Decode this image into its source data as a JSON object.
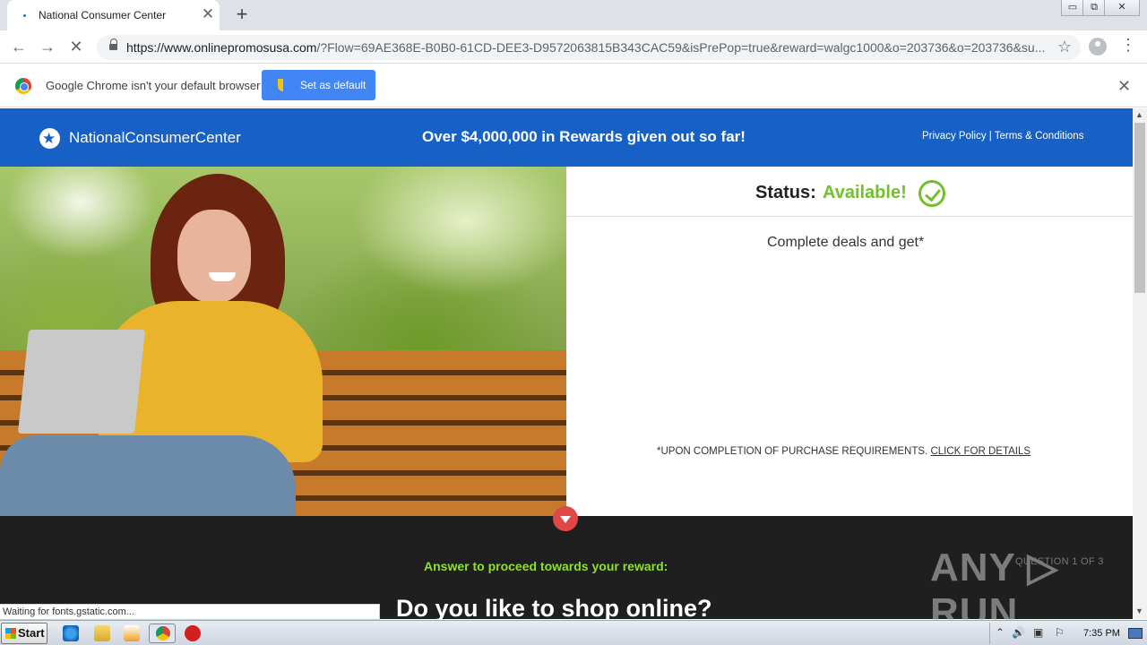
{
  "browser": {
    "tab_title": "National Consumer Center",
    "tab_close": "✕",
    "new_tab": "+",
    "url_host": "https://www.onlinepromosusa.com",
    "url_rest": "/?Flow=69AE368E-B0B0-61CD-DEE3-D9572063815B343CAC59&isPrePop=true&reward=walgc1000&o=203736&o=203736&su...",
    "back_icon": "←",
    "forward_icon": "→",
    "reload_icon": "✕",
    "star_icon": "☆",
    "menu_icon": "⋮",
    "window_controls": [
      "▭",
      "⧉",
      "✕"
    ]
  },
  "infobar": {
    "message": "Google Chrome isn't your default browser",
    "button_label": "Set as default",
    "close": "✕"
  },
  "site": {
    "brand": "NationalConsumerCenter",
    "rewards_banner": "Over $4,000,000 in Rewards given out so far!",
    "legal_links": "Privacy Policy | Terms & Conditions"
  },
  "panel": {
    "status_label": "Status:",
    "status_value": "Available!",
    "deals_text": "Complete deals and get*",
    "terms_text": "*UPON COMPLETION OF PURCHASE REQUIREMENTS.",
    "terms_link": "CLICK FOR DETAILS"
  },
  "question": {
    "prompt": "Answer to proceed towards your reward:",
    "counter": "QUESTION 1 OF 3",
    "text": "Do you like to shop online?"
  },
  "watermark": "ANY ▷ RUN",
  "status_bubble": "Waiting for fonts.gstatic.com...",
  "taskbar": {
    "start_label": "Start",
    "clock": "7:35 PM",
    "tray_icons": [
      "⌃",
      "🔊",
      "▣",
      "⚐"
    ]
  },
  "colors": {
    "header_blue": "#1760c6",
    "status_green": "#72c02c",
    "prompt_green": "#8ee02c",
    "dark_section": "#1f1f1f",
    "arrow_red": "#e04848"
  }
}
